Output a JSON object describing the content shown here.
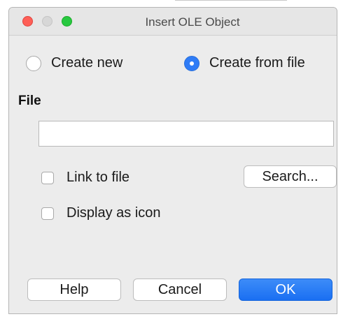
{
  "window": {
    "title": "Insert OLE Object"
  },
  "source": {
    "options": [
      {
        "label": "Create new",
        "selected": false
      },
      {
        "label": "Create from file",
        "selected": true
      }
    ]
  },
  "file": {
    "section_label": "File",
    "path_value": "",
    "search_label": "Search...",
    "link_to_file": {
      "label": "Link to file",
      "checked": false
    },
    "display_as_icon": {
      "label": "Display as icon",
      "checked": false
    }
  },
  "buttons": {
    "help_label": "Help",
    "cancel_label": "Cancel",
    "ok_label": "OK"
  },
  "colors": {
    "accent": "#2f7cf6",
    "close": "#fe5f57",
    "zoom": "#28c840",
    "window_bg": "#ececec"
  }
}
